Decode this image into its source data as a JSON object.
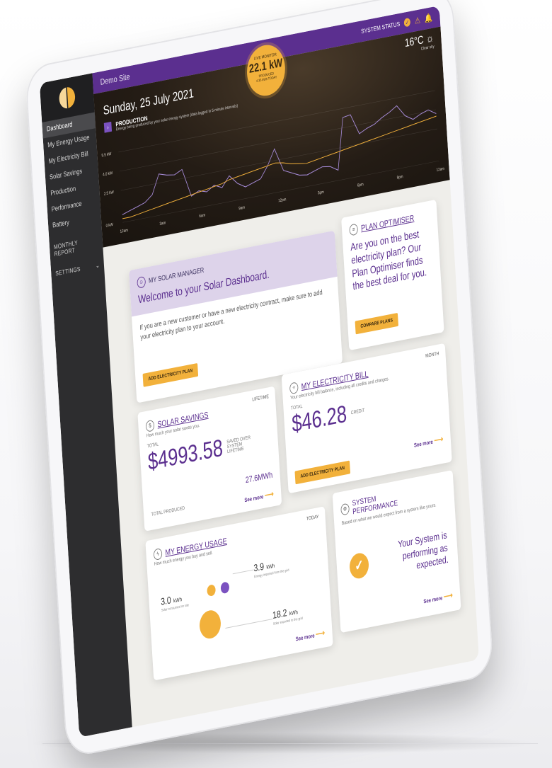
{
  "sidebar": {
    "items": [
      "Dashboard",
      "My Energy Usage",
      "My Electricity Bill",
      "Solar Savings",
      "Production",
      "Performance",
      "Battery"
    ],
    "monthly_report": "MONTHLY REPORT",
    "settings": "SETTINGS"
  },
  "topbar": {
    "site": "Demo Site",
    "system_status": "SYSTEM STATUS"
  },
  "live": {
    "label": "LIVE MONITOR",
    "value": "22.1 kW",
    "sub1": "PRODUCED",
    "sub2": "4.35 kWh TODAY"
  },
  "weather": {
    "temp": "16°C",
    "desc": "Clear sky"
  },
  "hero": {
    "date": "Sunday, 25 July 2021",
    "production_title": "PRODUCTION",
    "production_sub": "Energy being produced by your solar energy system (data logged in 5-minute intervals)"
  },
  "chart_data": {
    "type": "line",
    "title": "PRODUCTION",
    "y_ticks": [
      "0 kW",
      "2.5 kW",
      "4.0 kW",
      "5.5 kW"
    ],
    "x_ticks": [
      "12am",
      "3am",
      "6am",
      "9am",
      "12pm",
      "3pm",
      "6pm",
      "9pm",
      "12am"
    ],
    "series": [
      {
        "color": "#a58ad6",
        "values": [
          0.6,
          0.8,
          1.0,
          1.2,
          1.7,
          3.2,
          3.0,
          2.9,
          3.2,
          1.0,
          1.3,
          1.1,
          1.5,
          1.2,
          2.0,
          1.3,
          0.9,
          1.1,
          1.3,
          2.2,
          3.4,
          1.6,
          1.3,
          1.0,
          0.9,
          1.1,
          1.3,
          1.2,
          0.8,
          4.8,
          4.9,
          3.3,
          3.6,
          3.8,
          4.2,
          4.5,
          4.9,
          4.0,
          3.6,
          3.9,
          4.1,
          3.7
        ]
      },
      {
        "color": "#f2b13b",
        "values": [
          0.3,
          0.3,
          0.4,
          0.5,
          0.6,
          0.7,
          0.8,
          0.9,
          1.0,
          1.1,
          1.2,
          1.3,
          1.4,
          1.5,
          1.7,
          1.8,
          1.9,
          2.0,
          2.1,
          2.2,
          2.3,
          2.2,
          2.0,
          1.9,
          1.8,
          1.9,
          2.0,
          2.1,
          2.2,
          2.3,
          2.4,
          2.5,
          2.6,
          2.7,
          2.8,
          2.9,
          3.0,
          3.1,
          3.2,
          3.3,
          3.4,
          3.5
        ]
      }
    ],
    "ylim": [
      0,
      6
    ]
  },
  "solar_manager": {
    "title": "MY SOLAR MANAGER",
    "heading": "Welcome to your Solar Dashboard.",
    "body": "If you are a new customer or have a new electricity contract, make sure to add your electricity plan to your account.",
    "button": "ADD ELECTRICITY PLAN"
  },
  "plan_optimiser": {
    "title": "PLAN OPTIMISER",
    "question": "Are you on the best electricity plan? Our Plan Optimiser finds the best deal for you.",
    "button": "COMPARE PLANS"
  },
  "solar_savings": {
    "title": "SOLAR SAVINGS",
    "tag": "LIFETIME",
    "sub": "How much your solar saves you.",
    "total_label": "TOTAL",
    "amount": "$4993.58",
    "amount_note": "SAVED OVER SYSTEM LIFETIME",
    "produced_value": "27.6MWh",
    "produced_label": "TOTAL PRODUCED",
    "see_more": "See more"
  },
  "electricity_bill": {
    "title": "MY ELECTRICITY BILL",
    "tag": "MONTH",
    "sub": "Your electricity bill balance, including all credits and charges.",
    "total_label": "TOTAL",
    "amount": "$46.28",
    "amount_note": "CREDIT",
    "button": "ADD ELECTRICITY PLAN",
    "see_more": "See more"
  },
  "energy_usage": {
    "title": "MY ENERGY USAGE",
    "tag": "TODAY",
    "sub": "How much energy you buy and sell.",
    "left_value": "3.0",
    "left_unit": "kWh",
    "left_note": "Solar consumed on site",
    "top_value": "3.9",
    "top_unit": "kWh",
    "top_note": "Energy imported from the grid",
    "bottom_value": "18.2",
    "bottom_unit": "kWh",
    "bottom_note": "Solar exported to the grid",
    "see_more": "See more"
  },
  "system_performance": {
    "title": "SYSTEM PERFORMANCE",
    "sub": "Based on what we would expect from a system like yours.",
    "message": "Your System is performing as expected.",
    "see_more": "See more"
  }
}
